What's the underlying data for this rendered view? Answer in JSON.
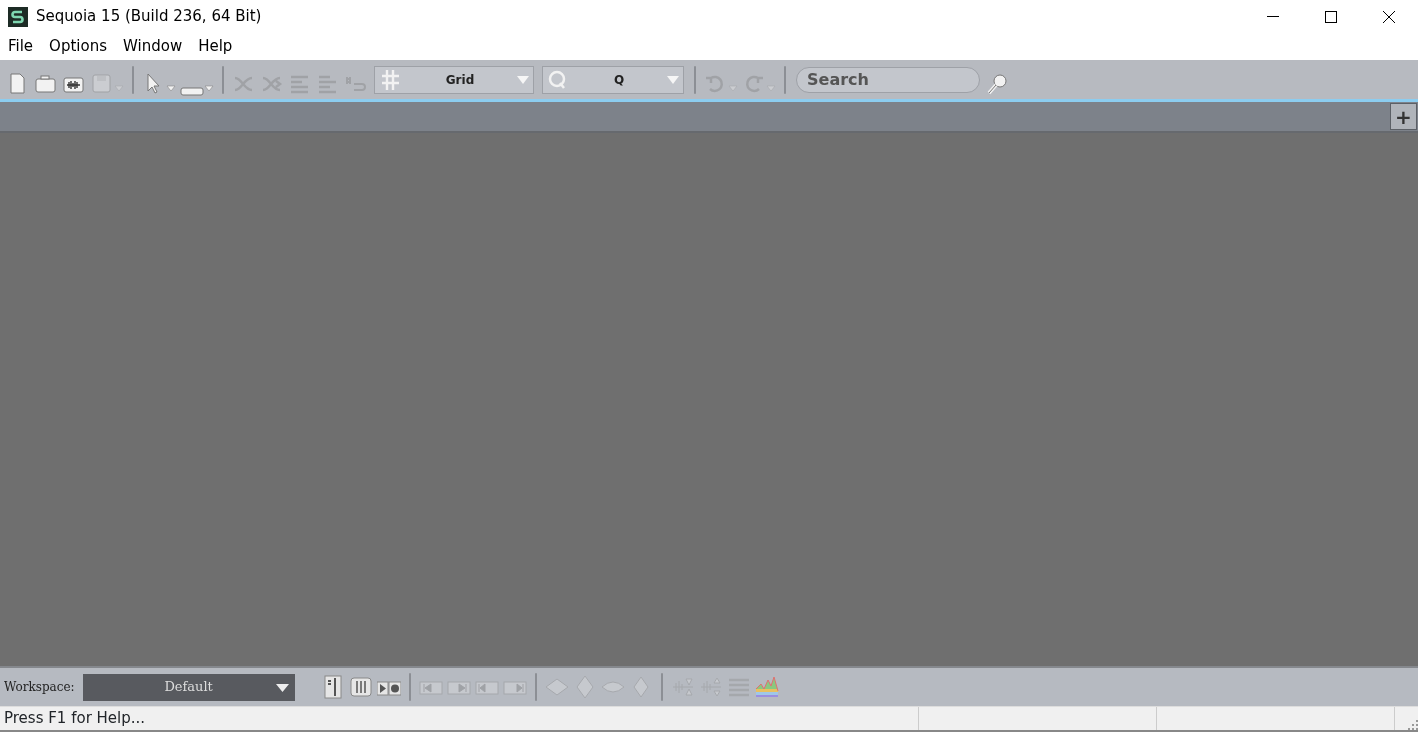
{
  "window": {
    "title": "Sequoia 15 (Build 236, 64 Bit)"
  },
  "menu": [
    "File",
    "Options",
    "Window",
    "Help"
  ],
  "toolbar": [
    {
      "kind": "button",
      "disabled": false,
      "dropdown": false
    },
    {
      "kind": "button",
      "disabled": false,
      "dropdown": false
    },
    {
      "kind": "button",
      "disabled": false,
      "dropdown": false
    },
    {
      "kind": "button",
      "disabled": true,
      "dropdown": true
    },
    {
      "kind": "separator"
    },
    {
      "kind": "button",
      "disabled": false,
      "dropdown": true
    },
    {
      "kind": "button",
      "disabled": false,
      "dropdown": true
    },
    {
      "kind": "separator"
    },
    {
      "kind": "button",
      "disabled": true,
      "dropdown": false
    },
    {
      "kind": "button",
      "disabled": true,
      "dropdown": false
    },
    {
      "kind": "button",
      "disabled": true,
      "dropdown": false
    },
    {
      "kind": "button",
      "disabled": true,
      "dropdown": false
    },
    {
      "kind": "button",
      "disabled": true,
      "dropdown": false
    },
    {
      "kind": "combo",
      "value": "Grid"
    },
    {
      "kind": "combo",
      "value": "Q"
    },
    {
      "kind": "separator"
    },
    {
      "kind": "button",
      "disabled": true,
      "dropdown": true
    },
    {
      "kind": "button",
      "disabled": true,
      "dropdown": true
    },
    {
      "kind": "separator"
    },
    {
      "kind": "search",
      "placeholder": "Search"
    },
    {
      "kind": "button",
      "disabled": false,
      "dropdown": false
    }
  ],
  "tabbar": {
    "add_button": "+"
  },
  "workspace": {
    "label": "Workspace:",
    "value": "Default"
  },
  "bottom_toolbar": [
    {
      "kind": "button",
      "disabled": false
    },
    {
      "kind": "button",
      "disabled": false
    },
    {
      "kind": "button",
      "disabled": false
    },
    {
      "kind": "separator"
    },
    {
      "kind": "button",
      "disabled": true
    },
    {
      "kind": "button",
      "disabled": true
    },
    {
      "kind": "button",
      "disabled": true
    },
    {
      "kind": "button",
      "disabled": true
    },
    {
      "kind": "separator"
    },
    {
      "kind": "button",
      "disabled": true
    },
    {
      "kind": "button",
      "disabled": true
    },
    {
      "kind": "button",
      "disabled": true
    },
    {
      "kind": "button",
      "disabled": true
    },
    {
      "kind": "separator"
    },
    {
      "kind": "button",
      "disabled": true
    },
    {
      "kind": "button",
      "disabled": true
    },
    {
      "kind": "button",
      "disabled": true
    },
    {
      "kind": "button",
      "disabled": false
    }
  ],
  "status_bar": {
    "message": "Press F1 for Help..."
  }
}
